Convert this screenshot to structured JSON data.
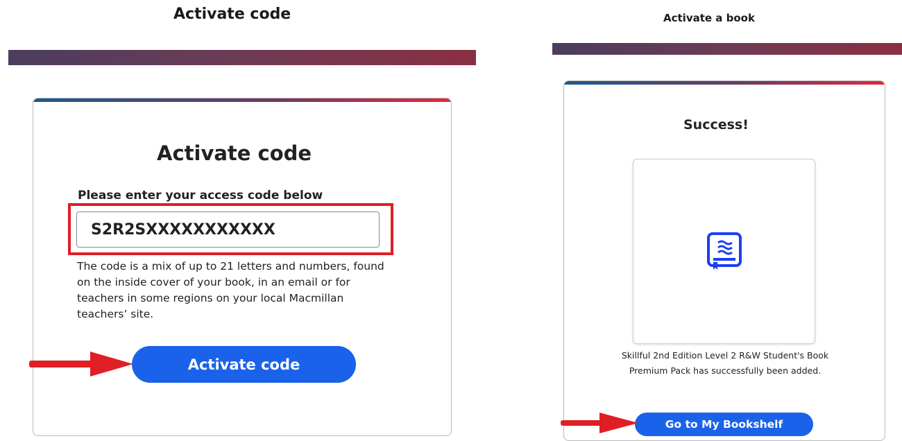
{
  "left_panel": {
    "header_title": "Activate code",
    "card_title": "Activate code",
    "field_label": "Please enter your access code below",
    "code_value": "S2R2SXXXXXXXXXXX",
    "help_text": "The code is a mix of up to 21 letters and numbers, found on the inside cover of your book, in an email or for teachers in some regions on your local Macmillan teachers’ site.",
    "activate_button_label": "Activate code"
  },
  "right_panel": {
    "header_title": "Activate a book",
    "success_title": "Success!",
    "success_message": "Skillful 2nd Edition Level 2 R&W Student's Book Premium Pack has successfully been added.",
    "bookshelf_button_label": "Go to My Bookshelf"
  },
  "colors": {
    "primary_button": "#1a62ea",
    "annotation_red": "#e01e25"
  },
  "icons": [
    "book-icon",
    "arrow-icon"
  ]
}
